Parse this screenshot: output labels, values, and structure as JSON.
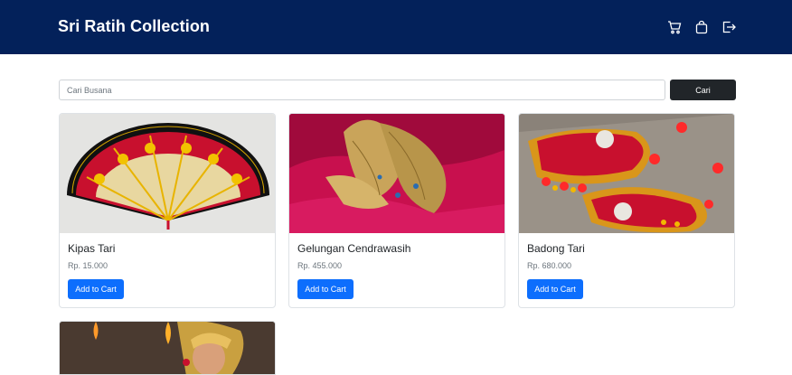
{
  "navbar": {
    "brand": "Sri Ratih Collection",
    "icons": [
      "cart-icon",
      "bag-icon",
      "logout-icon"
    ],
    "background": "#03215a"
  },
  "search": {
    "placeholder": "Cari Busana",
    "value": "",
    "button_label": "Cari"
  },
  "products": [
    {
      "title": "Kipas Tari",
      "price": "Rp. 15.000",
      "button_label": "Add to Cart"
    },
    {
      "title": "Gelungan Cendrawasih",
      "price": "Rp. 455.000",
      "button_label": "Add to Cart"
    },
    {
      "title": "Badong Tari",
      "price": "Rp. 680.000",
      "button_label": "Add to Cart"
    }
  ],
  "colors": {
    "primary_button": "#0d6efd",
    "dark_button": "#212529"
  }
}
